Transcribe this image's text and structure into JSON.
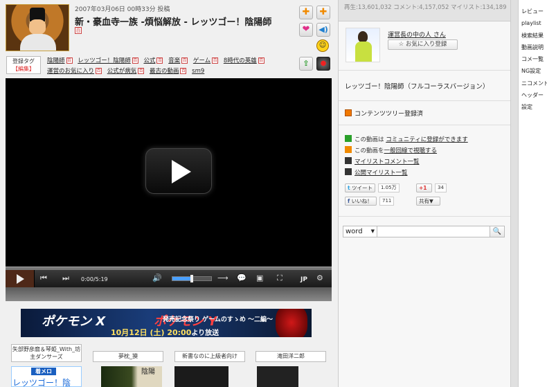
{
  "video": {
    "upload_date": "2007年03月06日 00時33分 投稿",
    "title": "新・豪血寺一族 -煩悩解放 - レッツゴー！陰陽師",
    "h_badge": "百"
  },
  "tag_box": {
    "label": "登録タグ",
    "edit": "【編集】"
  },
  "tags": [
    "陰陽師",
    "レッツゴー！陰陽師",
    "公式",
    "音楽",
    "ゲーム",
    "8時代の英雄",
    "運営のお気に入り",
    "公式が病気",
    "最古の動画",
    "sm9"
  ],
  "player": {
    "time": "0:00/5:19",
    "lang": "JP",
    "volume_level": 0.48,
    "play_progress": 0
  },
  "banner": {
    "logo_x": "ポケモン X",
    "logo_y": "ポケモン Y",
    "label": "発売記念祭り ゲームのすゝめ ～二編～",
    "date": "10月12日 (土) 20:00",
    "suffix": "より放送"
  },
  "recommendations": [
    {
      "title": "矢部野彦麿＆琴姫_With_坊主ダンサーズ",
      "badge": "着メロ",
      "thumb_text": "レッツゴー！陰"
    },
    {
      "title": "夢枕_獏",
      "thumb_text": "陰陽"
    },
    {
      "title": "新書なのに上級者向け"
    },
    {
      "title": "滝田洋二郎"
    }
  ],
  "stats": {
    "text": "再生:13,601,032 コメント:4,157,052 マイリスト:134,189"
  },
  "uploader": {
    "name": "運営長の中の人 さん",
    "fav_button": "☆ お気に入り登録"
  },
  "description": "レッツゴー！陰陽師（フルコーラスバージョン）",
  "content_tree": "コンテンツツリー登録済",
  "links": {
    "community_prefix": "この動画は",
    "community_link": "コミュニティに登録ができます",
    "normal_prefix": "この動画を",
    "normal_link": "一般回線で視聴する",
    "mylist_comments": "マイリストコメント一覧",
    "public_mylist": "公開マイリスト一覧"
  },
  "social": {
    "tweet": "ツイート",
    "tweet_count": "1.05万",
    "gplus": "+1",
    "gplus_count": "34",
    "like": "いいね！",
    "like_count": "711",
    "share": "共有▼"
  },
  "search": {
    "mode": "word",
    "placeholder": ""
  },
  "sidebar": [
    "レビュー",
    "playlist",
    "検索結果",
    "動画説明",
    "コメ一覧",
    "NG設定",
    "ニコメンド",
    "ヘッダー",
    "設定"
  ],
  "colors": {
    "accent_orange": "#f08a00",
    "link": "#222222",
    "panel_bg": "#f7f7f7",
    "player_bg": "#000000"
  }
}
